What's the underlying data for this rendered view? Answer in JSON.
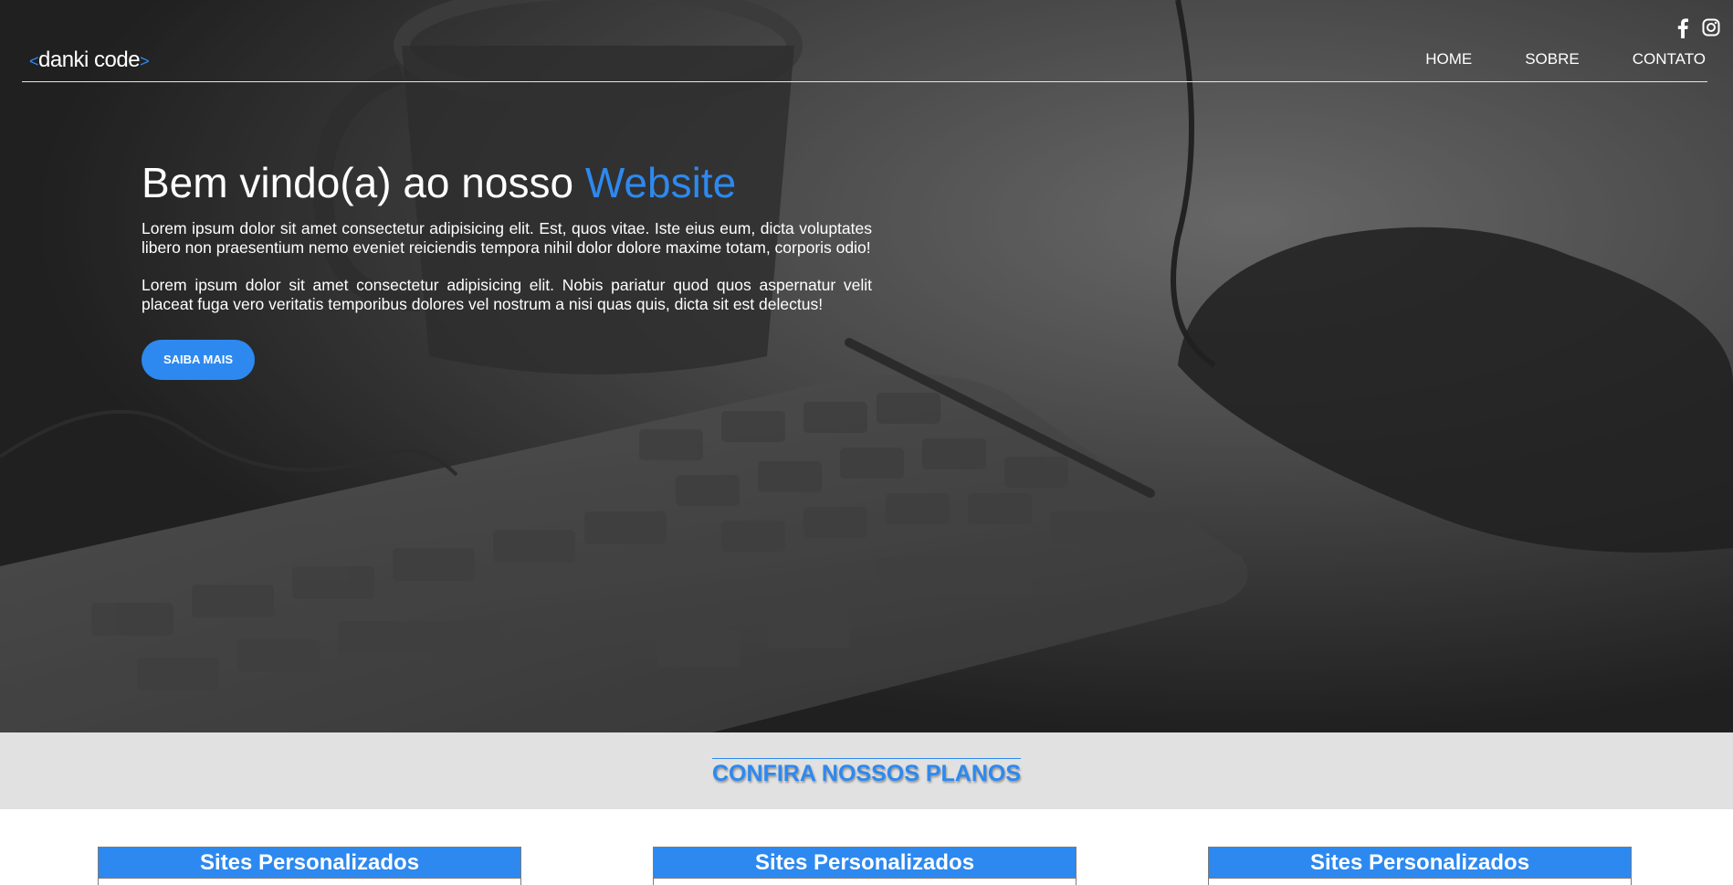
{
  "header": {
    "logo": {
      "bracket_open": "<",
      "text": "danki code",
      "bracket_close": ">"
    },
    "nav": [
      "HOME",
      "SOBRE",
      "CONTATO"
    ],
    "social_icons": [
      "facebook-icon",
      "instagram-icon"
    ]
  },
  "hero": {
    "title_main": "Bem vindo(a) ao nosso ",
    "title_accent": "Website",
    "paragraph_1": "Lorem ipsum dolor sit amet consectetur adipisicing elit. Est, quos vitae. Iste eius eum, dicta voluptates libero non praesentium nemo eveniet reiciendis tempora nihil dolor dolore maxime totam, corporis odio!",
    "paragraph_2": "Lorem ipsum dolor sit amet consectetur adipisicing elit. Nobis pariatur quod quos aspernatur velit placeat fuga vero veritatis temporibus dolores vel nostrum a nisi quas quis, dicta sit est delectus!",
    "button_label": "SAIBA MAIS"
  },
  "planos": {
    "title": "CONFIRA NOSSOS PLANOS",
    "cards": [
      {
        "title": "Sites Personalizados"
      },
      {
        "title": "Sites Personalizados"
      },
      {
        "title": "Sites Personalizados"
      }
    ]
  },
  "colors": {
    "accent": "#2d89ef",
    "planos_bg": "#e1e1e1",
    "text_light": "#ffffff"
  }
}
